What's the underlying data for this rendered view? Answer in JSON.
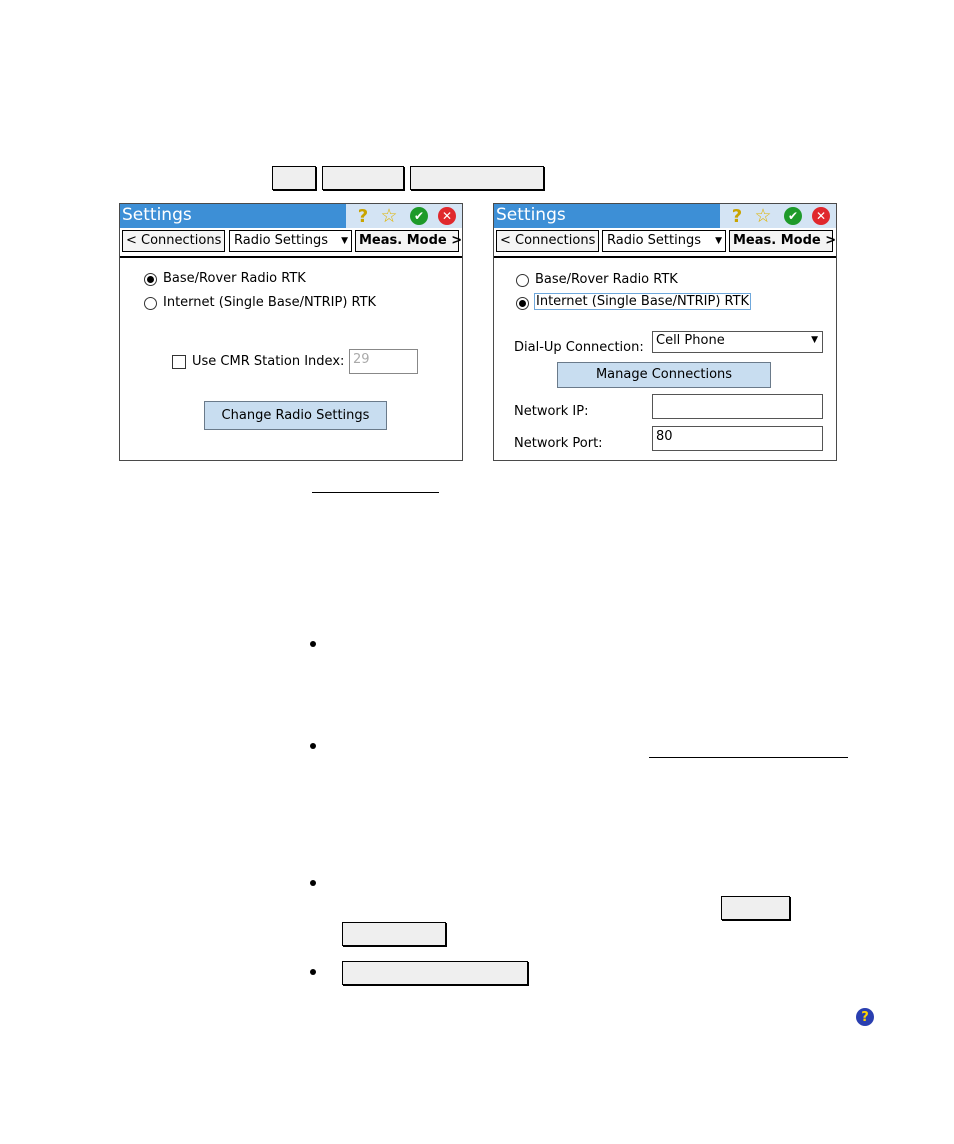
{
  "screen_left": {
    "title": "Settings",
    "tabs": {
      "prev": "< Connections",
      "current": "Radio Settings",
      "next": "Meas. Mode >"
    },
    "radio_options": [
      {
        "label": "Base/Rover Radio RTK",
        "selected": true
      },
      {
        "label": "Internet (Single Base/NTRIP) RTK",
        "selected": false
      }
    ],
    "cmr": {
      "label": "Use CMR Station Index:",
      "value": "29",
      "checked": false
    },
    "change_button": "Change Radio Settings"
  },
  "screen_right": {
    "title": "Settings",
    "tabs": {
      "prev": "< Connections",
      "current": "Radio Settings",
      "next": "Meas. Mode >"
    },
    "radio_options": [
      {
        "label": "Base/Rover Radio RTK",
        "selected": false
      },
      {
        "label": "Internet (Single Base/NTRIP) RTK",
        "selected": true
      }
    ],
    "dialup": {
      "label": "Dial-Up Connection:",
      "value": "Cell Phone"
    },
    "manage_button": "Manage Connections",
    "network_ip": {
      "label": "Network IP:",
      "value": ""
    },
    "network_port": {
      "label": "Network Port:",
      "value": "80"
    }
  },
  "colors": {
    "titlebar": "#3d8fd6",
    "button_fill": "#c8ddf0",
    "ok_icon": "#1e9a2a",
    "close_icon": "#e0282d",
    "help_icon": "#2a3fb0"
  },
  "icons": [
    "help-icon",
    "favorite-star-icon",
    "ok-check-icon",
    "close-icon",
    "help-question-icon"
  ]
}
